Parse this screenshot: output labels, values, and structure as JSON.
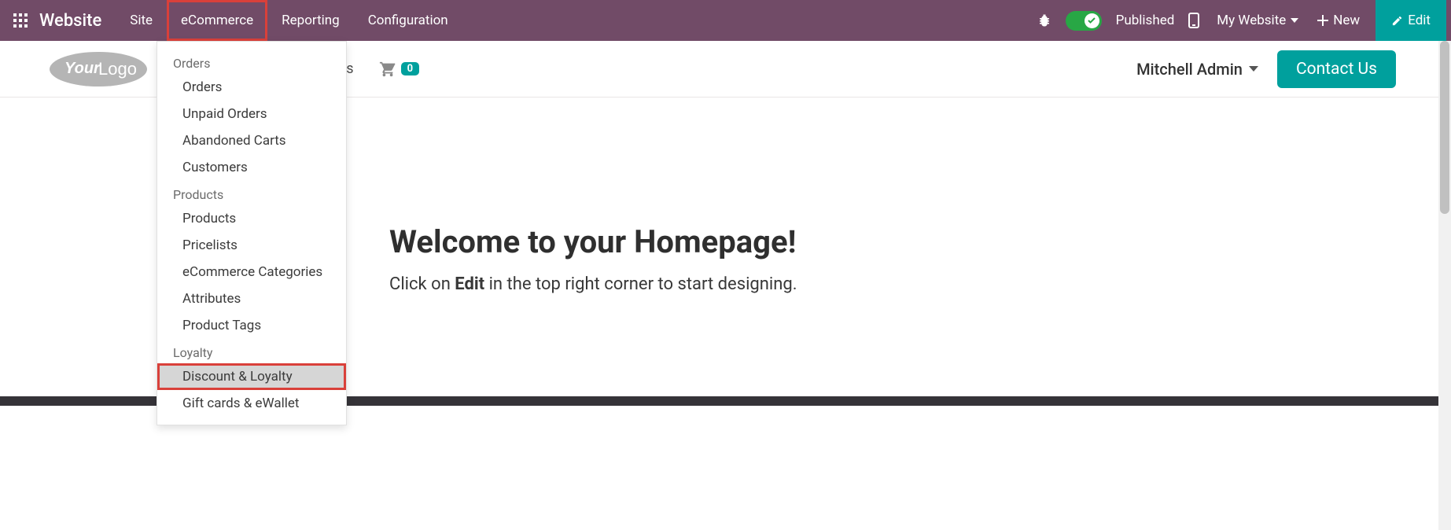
{
  "topbar": {
    "app_title": "Website",
    "menu": {
      "site": "Site",
      "ecommerce": "eCommerce",
      "reporting": "Reporting",
      "configuration": "Configuration"
    },
    "published_label": "Published",
    "my_website_label": "My Website",
    "new_label": "New",
    "edit_label": "Edit"
  },
  "dropdown": {
    "orders_section": "Orders",
    "orders_items": [
      "Orders",
      "Unpaid Orders",
      "Abandoned Carts",
      "Customers"
    ],
    "products_section": "Products",
    "products_items": [
      "Products",
      "Pricelists",
      "eCommerce Categories",
      "Attributes",
      "Product Tags"
    ],
    "loyalty_section": "Loyalty",
    "loyalty_items": [
      "Discount & Loyalty",
      "Gift cards & eWallet"
    ]
  },
  "siteheader": {
    "contact_item_partial": "t us",
    "cart_count": "0"
  },
  "main": {
    "welcome_prefix": "Welcome to your ",
    "welcome_strong": "Homepage",
    "welcome_suffix": "!",
    "sub_prefix": "Click on ",
    "sub_strong": "Edit",
    "sub_suffix": " in the top right corner to start designing."
  },
  "account": {
    "name": "Mitchell Admin",
    "contact_btn": "Contact Us"
  }
}
